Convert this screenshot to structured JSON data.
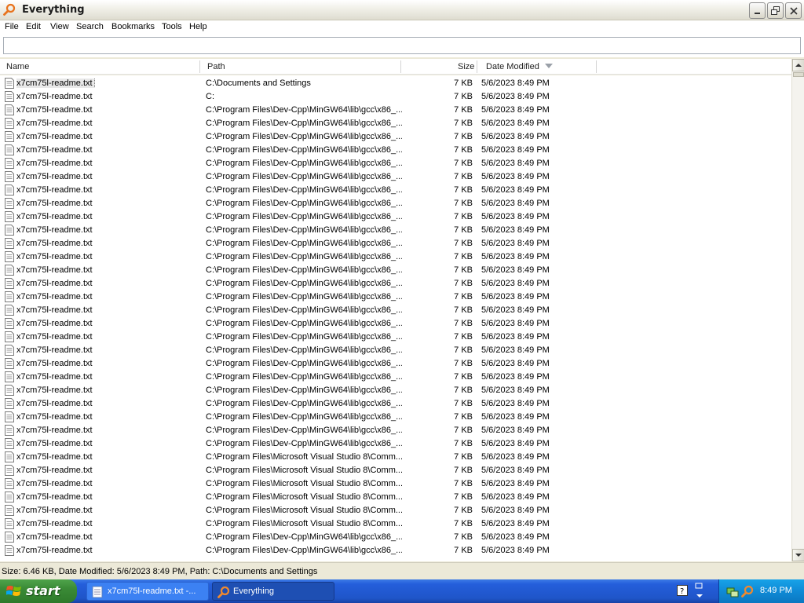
{
  "window": {
    "title": "Everything",
    "controls": [
      "minimize",
      "maximize",
      "close"
    ]
  },
  "menu": [
    "File",
    "Edit",
    "View",
    "Search",
    "Bookmarks",
    "Tools",
    "Help"
  ],
  "search": {
    "value": "",
    "placeholder": ""
  },
  "columns": {
    "name": "Name",
    "path": "Path",
    "size": "Size",
    "date_modified": "Date Modified",
    "sorted_by": "date_modified",
    "sort_direction": "descending"
  },
  "rows": [
    {
      "name": "x7cm75l-readme.txt",
      "path": "C:\\Documents and Settings",
      "size": "7 KB",
      "date": "5/6/2023 8:49 PM",
      "selected": true
    },
    {
      "name": "x7cm75l-readme.txt",
      "path": "C:",
      "size": "7 KB",
      "date": "5/6/2023 8:49 PM"
    },
    {
      "name": "x7cm75l-readme.txt",
      "path": "C:\\Program Files\\Dev-Cpp\\MinGW64\\lib\\gcc\\x86_...",
      "size": "7 KB",
      "date": "5/6/2023 8:49 PM"
    },
    {
      "name": "x7cm75l-readme.txt",
      "path": "C:\\Program Files\\Dev-Cpp\\MinGW64\\lib\\gcc\\x86_...",
      "size": "7 KB",
      "date": "5/6/2023 8:49 PM"
    },
    {
      "name": "x7cm75l-readme.txt",
      "path": "C:\\Program Files\\Dev-Cpp\\MinGW64\\lib\\gcc\\x86_...",
      "size": "7 KB",
      "date": "5/6/2023 8:49 PM"
    },
    {
      "name": "x7cm75l-readme.txt",
      "path": "C:\\Program Files\\Dev-Cpp\\MinGW64\\lib\\gcc\\x86_...",
      "size": "7 KB",
      "date": "5/6/2023 8:49 PM"
    },
    {
      "name": "x7cm75l-readme.txt",
      "path": "C:\\Program Files\\Dev-Cpp\\MinGW64\\lib\\gcc\\x86_...",
      "size": "7 KB",
      "date": "5/6/2023 8:49 PM"
    },
    {
      "name": "x7cm75l-readme.txt",
      "path": "C:\\Program Files\\Dev-Cpp\\MinGW64\\lib\\gcc\\x86_...",
      "size": "7 KB",
      "date": "5/6/2023 8:49 PM"
    },
    {
      "name": "x7cm75l-readme.txt",
      "path": "C:\\Program Files\\Dev-Cpp\\MinGW64\\lib\\gcc\\x86_...",
      "size": "7 KB",
      "date": "5/6/2023 8:49 PM"
    },
    {
      "name": "x7cm75l-readme.txt",
      "path": "C:\\Program Files\\Dev-Cpp\\MinGW64\\lib\\gcc\\x86_...",
      "size": "7 KB",
      "date": "5/6/2023 8:49 PM"
    },
    {
      "name": "x7cm75l-readme.txt",
      "path": "C:\\Program Files\\Dev-Cpp\\MinGW64\\lib\\gcc\\x86_...",
      "size": "7 KB",
      "date": "5/6/2023 8:49 PM"
    },
    {
      "name": "x7cm75l-readme.txt",
      "path": "C:\\Program Files\\Dev-Cpp\\MinGW64\\lib\\gcc\\x86_...",
      "size": "7 KB",
      "date": "5/6/2023 8:49 PM"
    },
    {
      "name": "x7cm75l-readme.txt",
      "path": "C:\\Program Files\\Dev-Cpp\\MinGW64\\lib\\gcc\\x86_...",
      "size": "7 KB",
      "date": "5/6/2023 8:49 PM"
    },
    {
      "name": "x7cm75l-readme.txt",
      "path": "C:\\Program Files\\Dev-Cpp\\MinGW64\\lib\\gcc\\x86_...",
      "size": "7 KB",
      "date": "5/6/2023 8:49 PM"
    },
    {
      "name": "x7cm75l-readme.txt",
      "path": "C:\\Program Files\\Dev-Cpp\\MinGW64\\lib\\gcc\\x86_...",
      "size": "7 KB",
      "date": "5/6/2023 8:49 PM"
    },
    {
      "name": "x7cm75l-readme.txt",
      "path": "C:\\Program Files\\Dev-Cpp\\MinGW64\\lib\\gcc\\x86_...",
      "size": "7 KB",
      "date": "5/6/2023 8:49 PM"
    },
    {
      "name": "x7cm75l-readme.txt",
      "path": "C:\\Program Files\\Dev-Cpp\\MinGW64\\lib\\gcc\\x86_...",
      "size": "7 KB",
      "date": "5/6/2023 8:49 PM"
    },
    {
      "name": "x7cm75l-readme.txt",
      "path": "C:\\Program Files\\Dev-Cpp\\MinGW64\\lib\\gcc\\x86_...",
      "size": "7 KB",
      "date": "5/6/2023 8:49 PM"
    },
    {
      "name": "x7cm75l-readme.txt",
      "path": "C:\\Program Files\\Dev-Cpp\\MinGW64\\lib\\gcc\\x86_...",
      "size": "7 KB",
      "date": "5/6/2023 8:49 PM"
    },
    {
      "name": "x7cm75l-readme.txt",
      "path": "C:\\Program Files\\Dev-Cpp\\MinGW64\\lib\\gcc\\x86_...",
      "size": "7 KB",
      "date": "5/6/2023 8:49 PM"
    },
    {
      "name": "x7cm75l-readme.txt",
      "path": "C:\\Program Files\\Dev-Cpp\\MinGW64\\lib\\gcc\\x86_...",
      "size": "7 KB",
      "date": "5/6/2023 8:49 PM"
    },
    {
      "name": "x7cm75l-readme.txt",
      "path": "C:\\Program Files\\Dev-Cpp\\MinGW64\\lib\\gcc\\x86_...",
      "size": "7 KB",
      "date": "5/6/2023 8:49 PM"
    },
    {
      "name": "x7cm75l-readme.txt",
      "path": "C:\\Program Files\\Dev-Cpp\\MinGW64\\lib\\gcc\\x86_...",
      "size": "7 KB",
      "date": "5/6/2023 8:49 PM"
    },
    {
      "name": "x7cm75l-readme.txt",
      "path": "C:\\Program Files\\Dev-Cpp\\MinGW64\\lib\\gcc\\x86_...",
      "size": "7 KB",
      "date": "5/6/2023 8:49 PM"
    },
    {
      "name": "x7cm75l-readme.txt",
      "path": "C:\\Program Files\\Dev-Cpp\\MinGW64\\lib\\gcc\\x86_...",
      "size": "7 KB",
      "date": "5/6/2023 8:49 PM"
    },
    {
      "name": "x7cm75l-readme.txt",
      "path": "C:\\Program Files\\Dev-Cpp\\MinGW64\\lib\\gcc\\x86_...",
      "size": "7 KB",
      "date": "5/6/2023 8:49 PM"
    },
    {
      "name": "x7cm75l-readme.txt",
      "path": "C:\\Program Files\\Dev-Cpp\\MinGW64\\lib\\gcc\\x86_...",
      "size": "7 KB",
      "date": "5/6/2023 8:49 PM"
    },
    {
      "name": "x7cm75l-readme.txt",
      "path": "C:\\Program Files\\Dev-Cpp\\MinGW64\\lib\\gcc\\x86_...",
      "size": "7 KB",
      "date": "5/6/2023 8:49 PM"
    },
    {
      "name": "x7cm75l-readme.txt",
      "path": "C:\\Program Files\\Microsoft Visual Studio 8\\Comm...",
      "size": "7 KB",
      "date": "5/6/2023 8:49 PM"
    },
    {
      "name": "x7cm75l-readme.txt",
      "path": "C:\\Program Files\\Microsoft Visual Studio 8\\Comm...",
      "size": "7 KB",
      "date": "5/6/2023 8:49 PM"
    },
    {
      "name": "x7cm75l-readme.txt",
      "path": "C:\\Program Files\\Microsoft Visual Studio 8\\Comm...",
      "size": "7 KB",
      "date": "5/6/2023 8:49 PM"
    },
    {
      "name": "x7cm75l-readme.txt",
      "path": "C:\\Program Files\\Microsoft Visual Studio 8\\Comm...",
      "size": "7 KB",
      "date": "5/6/2023 8:49 PM"
    },
    {
      "name": "x7cm75l-readme.txt",
      "path": "C:\\Program Files\\Microsoft Visual Studio 8\\Comm...",
      "size": "7 KB",
      "date": "5/6/2023 8:49 PM"
    },
    {
      "name": "x7cm75l-readme.txt",
      "path": "C:\\Program Files\\Microsoft Visual Studio 8\\Comm...",
      "size": "7 KB",
      "date": "5/6/2023 8:49 PM"
    },
    {
      "name": "x7cm75l-readme.txt",
      "path": "C:\\Program Files\\Dev-Cpp\\MinGW64\\lib\\gcc\\x86_...",
      "size": "7 KB",
      "date": "5/6/2023 8:49 PM"
    },
    {
      "name": "x7cm75l-readme.txt",
      "path": "C:\\Program Files\\Dev-Cpp\\MinGW64\\lib\\gcc\\x86_...",
      "size": "7 KB",
      "date": "5/6/2023 8:49 PM"
    }
  ],
  "status": "Size: 6.46 KB, Date Modified: 5/6/2023 8:49 PM, Path: C:\\Documents and Settings",
  "taskbar": {
    "start_label": "start",
    "tasks": [
      {
        "label": "x7cm75l-readme.txt -...",
        "active": false
      },
      {
        "label": "Everything",
        "active": true
      }
    ],
    "clock": "8:49 PM"
  },
  "icons": {
    "app": "magnifier-icon",
    "file": "text-file-icon",
    "sort": "sort-descending-icon"
  },
  "colors": {
    "taskbar_blue": "#245edb",
    "start_green": "#3a8a36",
    "tray_blue": "#0f8ad6",
    "app_icon_orange": "#e8721c"
  }
}
